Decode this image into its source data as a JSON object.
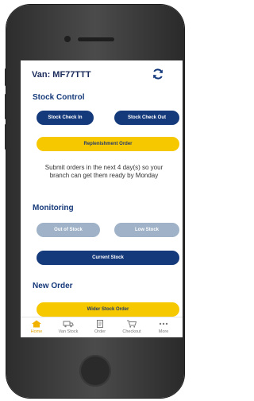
{
  "header": {
    "van_label": "Van: MF77TTT"
  },
  "stock_control": {
    "title": "Stock Control",
    "check_in": "Stock Check In",
    "check_out": "Stock Check Out",
    "replenishment": "Replenishment Order",
    "info": "Submit orders in the next 4 day(s) so your branch can get them ready by Monday"
  },
  "monitoring": {
    "title": "Monitoring",
    "out_of_stock": "Out of Stock",
    "low_stock": "Low Stock",
    "current_stock": "Current Stock"
  },
  "new_order": {
    "title": "New Order",
    "wider_stock": "Wider Stock Order"
  },
  "tabs": [
    {
      "label": "Home",
      "icon": "home-icon"
    },
    {
      "label": "Van Stock",
      "icon": "van-icon"
    },
    {
      "label": "Order",
      "icon": "order-icon"
    },
    {
      "label": "Checkout",
      "icon": "cart-icon"
    },
    {
      "label": "More",
      "icon": "more-icon"
    }
  ],
  "colors": {
    "navy": "#153a7c",
    "gold": "#f6c800",
    "grey": "#9fb2c7",
    "active_tab": "#e0a400"
  }
}
